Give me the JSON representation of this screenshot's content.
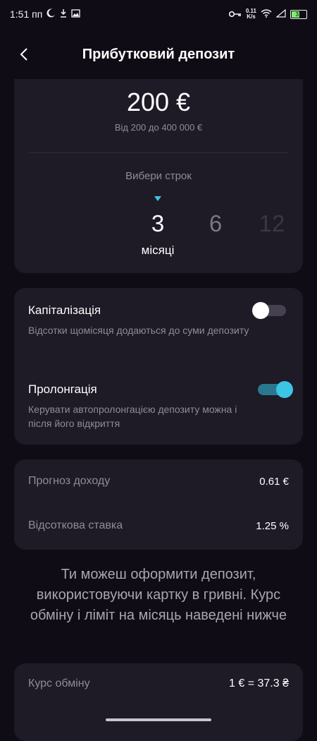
{
  "status_bar": {
    "time": "1:51 пп",
    "speed_value": "0.11",
    "speed_unit": "K/s",
    "battery": "31"
  },
  "header": {
    "title": "Прибутковий депозит"
  },
  "deposit": {
    "amount": "200 €",
    "range": "Від 200 до 400 000 €",
    "term_label": "Вибери строк",
    "terms": [
      "3",
      "6",
      "12"
    ],
    "selected_term": "3",
    "term_unit": "місяці"
  },
  "options": {
    "capitalization": {
      "title": "Капіталізація",
      "description": "Відсотки щомісяця додаються до суми депозиту",
      "enabled": false
    },
    "prolongation": {
      "title": "Пролонгація",
      "description": "Керувати автопролонгацією депозиту можна і після його відкриття",
      "enabled": true
    }
  },
  "info": {
    "forecast_label": "Прогноз доходу",
    "forecast_value": "0.61 €",
    "rate_label": "Відсоткова ставка",
    "rate_value": "1.25 %"
  },
  "notice": "Ти можеш оформити депозит, використовуючи картку в гривні. Курс обміну і ліміт на місяць наведені нижче",
  "exchange": {
    "label": "Курс обміну",
    "value": "1 € = 37.3 ₴"
  },
  "colors": {
    "background": "#0f0c16",
    "card": "#1e1a26",
    "accent": "#3cc4e4"
  }
}
